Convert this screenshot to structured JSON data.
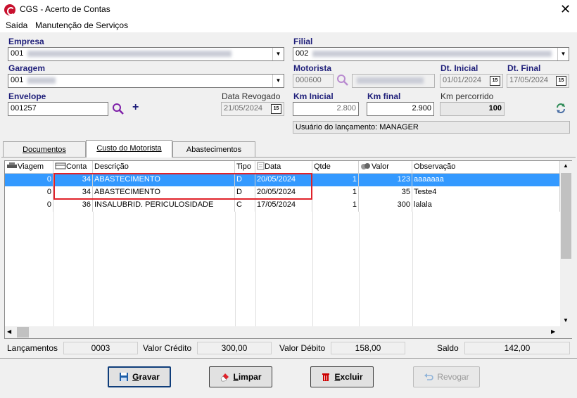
{
  "window": {
    "title": "CGS - Acerto de Contas",
    "close": "✕"
  },
  "menu": [
    "Saída",
    "Manutenção de Serviços"
  ],
  "form": {
    "empresa_label": "Empresa",
    "empresa_value": "001",
    "filial_label": "Filial",
    "filial_value": "002",
    "garagem_label": "Garagem",
    "garagem_value": "001",
    "motorista_label": "Motorista",
    "motorista_value": "000600",
    "dt_inicial_label": "Dt. Inicial",
    "dt_inicial_value": "01/01/2024",
    "dt_final_label": "Dt. Final",
    "dt_final_value": "17/05/2024",
    "envelope_label": "Envelope",
    "envelope_value": "001257",
    "data_revogado_label": "Data Revogado",
    "data_revogado_value": "21/05/2024",
    "km_inicial_label": "Km Inicial",
    "km_inicial_value": "2.800",
    "km_final_label": "Km final",
    "km_final_value": "2.900",
    "km_percorrido_label": "Km percorrido",
    "km_percorrido_value": "100",
    "usuario_text": "Usuário do lançamento: MANAGER",
    "cal_glyph": "15",
    "plus_glyph": "+"
  },
  "tabs": [
    "Documentos",
    "Custo do Motorista",
    "Abastecimentos"
  ],
  "grid": {
    "headers": [
      "Viagem",
      "Conta",
      "Descrição",
      "Tipo",
      "Data",
      "Qtde",
      "Valor",
      "Observação"
    ],
    "rows": [
      {
        "viagem": "0",
        "conta": "34",
        "descricao": "ABASTECIMENTO",
        "tipo": "D",
        "data": "20/05/2024",
        "qtde": "1",
        "valor": "123",
        "obs": "aaaaaaa"
      },
      {
        "viagem": "0",
        "conta": "34",
        "descricao": "ABASTECIMENTO",
        "tipo": "D",
        "data": "20/05/2024",
        "qtde": "1",
        "valor": "35",
        "obs": "Teste4"
      },
      {
        "viagem": "0",
        "conta": "36",
        "descricao": "INSALUBRID. PERICULOSIDADE",
        "tipo": "C",
        "data": "17/05/2024",
        "qtde": "1",
        "valor": "300",
        "obs": "lalala"
      }
    ]
  },
  "status": {
    "lancamentos_label": "Lançamentos",
    "lancamentos_value": "0003",
    "credito_label": "Valor Crédito",
    "credito_value": "300,00",
    "debito_label": "Valor Débito",
    "debito_value": "158,00",
    "saldo_label": "Saldo",
    "saldo_value": "142,00"
  },
  "buttons": {
    "gravar_first": "G",
    "gravar_rest": "ravar",
    "limpar_first": "L",
    "limpar_rest": "impar",
    "excluir_first": "E",
    "excluir_rest": "xcluir",
    "revogar": "Revogar"
  },
  "colors": {
    "selection": "#3399ff",
    "highlight_box": "#e0222a",
    "label_blue": "#1f1f7a"
  }
}
